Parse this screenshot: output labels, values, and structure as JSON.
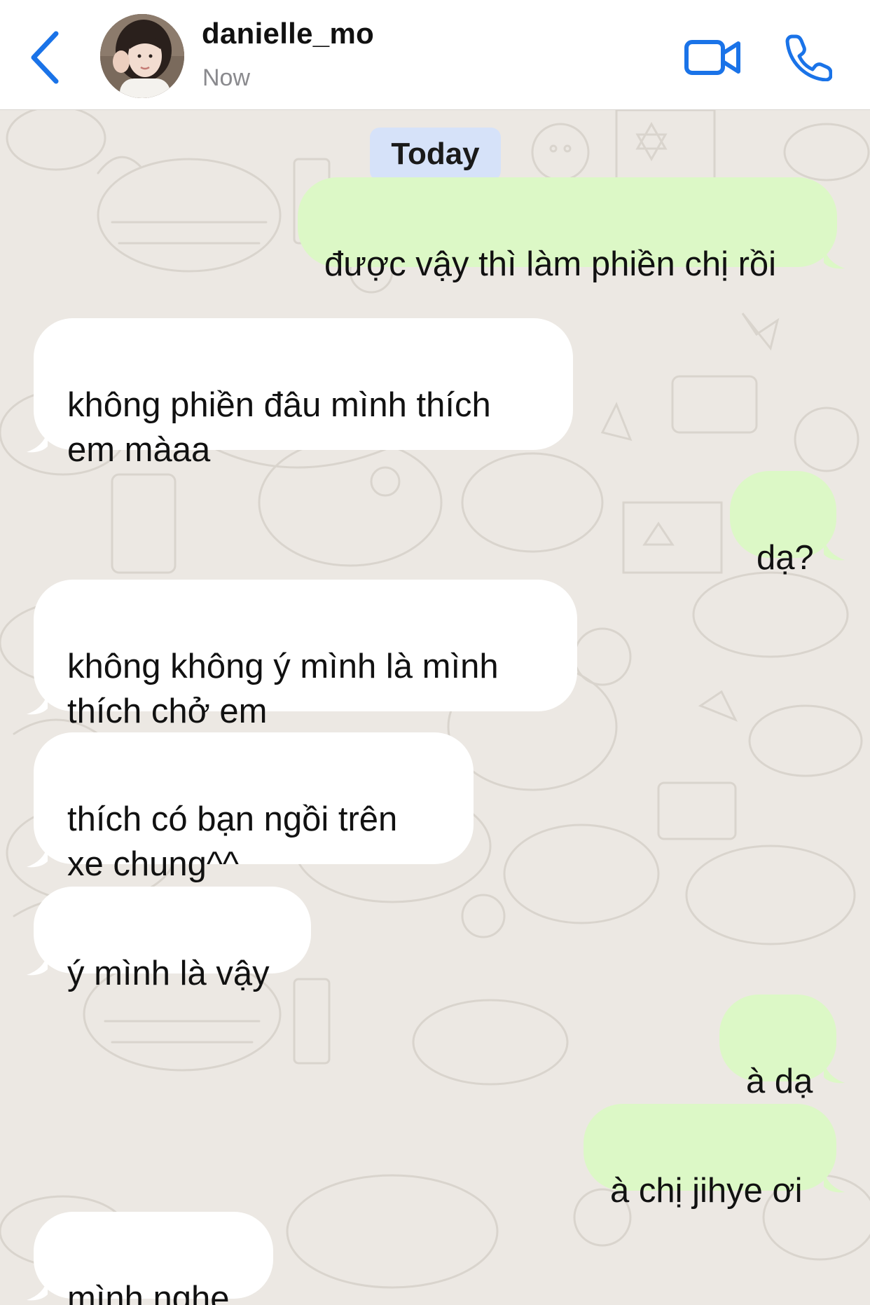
{
  "header": {
    "contact_name": "danielle_mo",
    "status": "Now",
    "icons": {
      "back": "chevron-left-icon",
      "video": "video-camera-icon",
      "call": "phone-icon"
    },
    "accent_color": "#1a73e8"
  },
  "chat": {
    "date_chip": "Today",
    "messages": [
      {
        "direction": "out",
        "text": "được vậy thì làm phiền chị rồi"
      },
      {
        "direction": "in",
        "text": "không phiền đâu mình thích\nem màaa"
      },
      {
        "direction": "out",
        "text": "dạ?"
      },
      {
        "direction": "in",
        "text": "không không ý mình là mình\nthích chở em"
      },
      {
        "direction": "in",
        "text": "thích có bạn ngồi trên\nxe chung^^"
      },
      {
        "direction": "in",
        "text": "ý mình là vậy"
      },
      {
        "direction": "out",
        "text": "à dạ"
      },
      {
        "direction": "out",
        "text": "à chị jihye ơi"
      },
      {
        "direction": "in",
        "text": "mình nghe"
      }
    ],
    "colors": {
      "incoming_bubble": "#ffffff",
      "outgoing_bubble": "#dcf8c6",
      "date_chip": "#d6e2f9",
      "background": "#ece8e3"
    }
  }
}
